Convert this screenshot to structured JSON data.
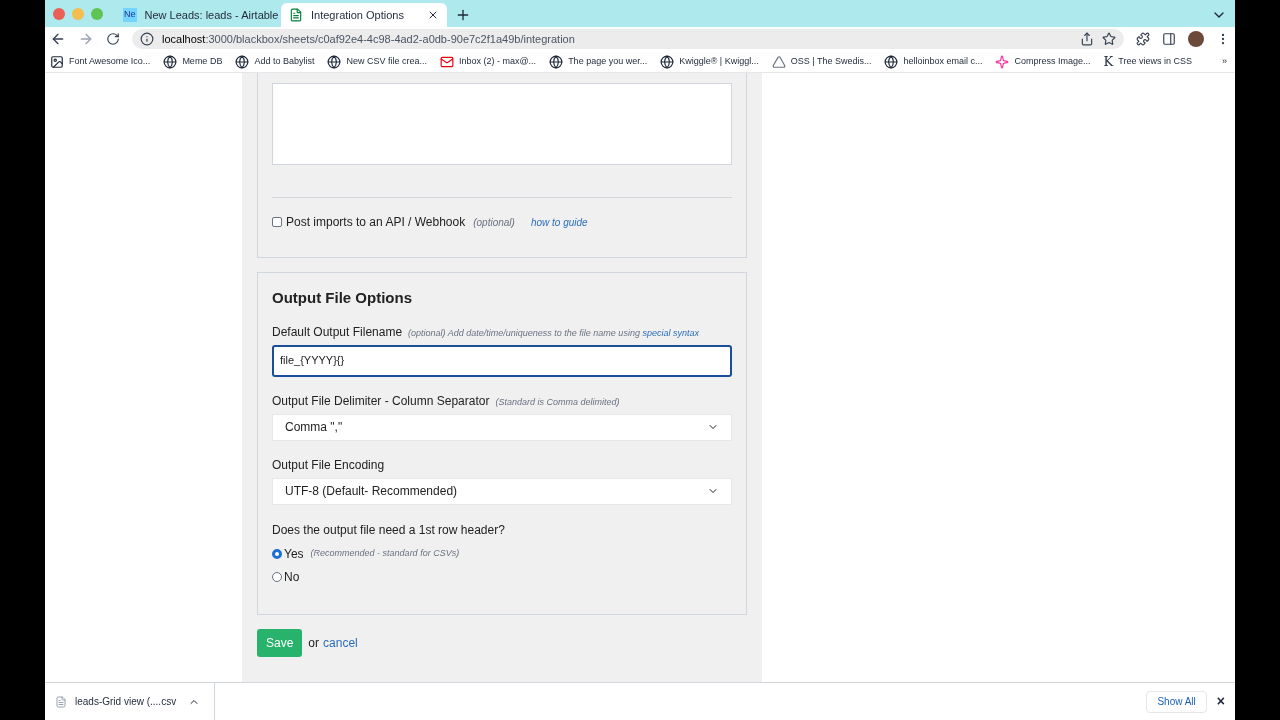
{
  "browser": {
    "tabs": [
      {
        "favicon": "Ne",
        "title": "New Leads: leads - Airtable",
        "selected": false
      },
      {
        "title": "Integration Options",
        "selected": true
      }
    ],
    "url_host": "localhost",
    "url_rest": ":3000/blackbox/sheets/c0af92e4-4c98-4ad2-a0db-90e7c2f1a49b/integration",
    "bookmarks": [
      {
        "kind": "image",
        "label": "Font Awesome Ico..."
      },
      {
        "kind": "globe",
        "label": "Meme DB"
      },
      {
        "kind": "globe",
        "label": "Add to Babylist"
      },
      {
        "kind": "globe",
        "label": "New CSV file crea..."
      },
      {
        "kind": "mail",
        "label": "Inbox (2) - max@..."
      },
      {
        "kind": "globe",
        "label": "The page you wer..."
      },
      {
        "kind": "globe",
        "label": "Kwiggle® | Kwiggl..."
      },
      {
        "kind": "triangle",
        "label": "OSS | The Swedis..."
      },
      {
        "kind": "globe",
        "label": "helloinbox email c..."
      },
      {
        "kind": "sparkle",
        "label": "Compress Image..."
      },
      {
        "kind": "letter",
        "icon_text": "K",
        "label": "Tree views in CSS"
      }
    ],
    "more": "»"
  },
  "webhook": {
    "checked": false,
    "label": "Post imports to an API / Webhook",
    "hint": "(optional)",
    "link": "how to guide"
  },
  "output": {
    "title": "Output File Options",
    "filename": {
      "label": "Default Output Filename",
      "hint": "(optional) Add date/time/uniqueness to the file name using",
      "link": "special syntax",
      "value": "file_{YYYY}{}"
    },
    "delimiter": {
      "label": "Output File Delimiter - Column Separator",
      "hint": "(Standard is Comma delimited)",
      "value": "Comma \",\""
    },
    "encoding": {
      "label": "Output File Encoding",
      "value": "UTF-8 (Default- Recommended)"
    },
    "header": {
      "question": "Does the output file need a 1st row header?",
      "options": [
        {
          "label": "Yes",
          "hint": "(Recommended - standard for CSVs)",
          "selected": true
        },
        {
          "label": "No",
          "selected": false
        }
      ]
    }
  },
  "actions": {
    "save": "Save",
    "or": "or",
    "cancel": "cancel"
  },
  "downloads": {
    "file": "leads-Grid view (....csv",
    "show_all": "Show All",
    "close": "×"
  }
}
